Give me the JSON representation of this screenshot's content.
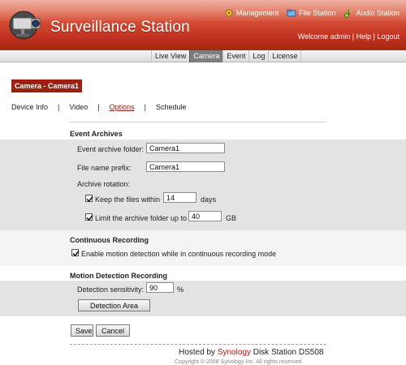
{
  "app": {
    "title": "Surveillance Station"
  },
  "topnav": {
    "management": "Management",
    "file_station": "File Station",
    "audio_station": "Audio Station"
  },
  "welcome": {
    "text": "Welcome admin",
    "help": "Help",
    "logout": "Logout",
    "sep": "|"
  },
  "tabs": [
    "Live View",
    "Camera",
    "Event",
    "Log",
    "License"
  ],
  "active_tab": "Camera",
  "camera_badge": "Camera - Camera1",
  "subtabs": [
    "Device Info",
    "Video",
    "Options",
    "Schedule"
  ],
  "subtab_sep": "|",
  "event_archives": {
    "title": "Event Archives",
    "folder_label": "Event archive folder:",
    "folder_value": "Camera1",
    "prefix_label": "File name prefix:",
    "prefix_value": "Camera1",
    "rotation_label": "Archive rotation:",
    "keep_label": "Keep the files within",
    "keep_value": "14",
    "keep_unit": "days",
    "keep_checked": true,
    "limit_label": "Limit the archive folder up to",
    "limit_value": "40",
    "limit_unit": "GB",
    "limit_checked": true
  },
  "continuous": {
    "title": "Continuous Recording",
    "enable_label": "Enable motion detection while in continuous recording mode",
    "enable_checked": true
  },
  "motion": {
    "title": "Motion Detection Recording",
    "sensitivity_label": "Detection sensitivity:",
    "sensitivity_value": "90",
    "sensitivity_unit": "%",
    "area_button": "Detection Area"
  },
  "buttons": {
    "save": "Save",
    "cancel": "Cancel"
  },
  "footer": {
    "hosted_prefix": "Hosted by ",
    "brand": "Synology",
    "hosted_suffix": " Disk Station DS508",
    "copyright": "Copyright © 2008 Synology Inc. All rights reserved."
  },
  "colors": {
    "header": "#c0311f",
    "badge": "#9e2010",
    "active_tab": "#7d7d7d"
  }
}
